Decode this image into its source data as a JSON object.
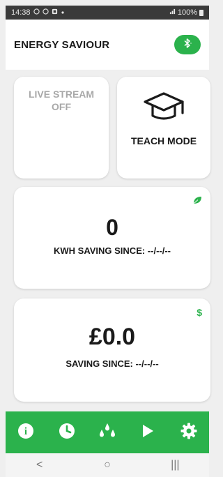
{
  "status_bar": {
    "time": "14:38",
    "notification_icons": [
      "whatsapp-icon",
      "whatsapp-icon",
      "gallery-icon",
      "dot-icon"
    ],
    "signal_icon": "signal-icon",
    "battery_percent": "100%",
    "battery_icon": "battery-icon"
  },
  "header": {
    "title": "ENERGY SAVIOUR",
    "bluetooth_icon": "bluetooth-icon"
  },
  "cards": {
    "live_stream": {
      "line1": "LIVE STREAM",
      "line2": "OFF"
    },
    "teach_mode": {
      "label": "TEACH MODE",
      "icon": "graduation-cap-icon"
    },
    "kwh": {
      "value": "0",
      "label": "KWH SAVING SINCE: --/--/--",
      "icon": "leaf-icon"
    },
    "money": {
      "value": "£0.0",
      "label": "SAVING SINCE: --/--/--",
      "icon": "dollar-icon",
      "icon_text": "$"
    }
  },
  "bottom_nav": {
    "items": [
      {
        "icon": "info-icon",
        "glyph": "i"
      },
      {
        "icon": "clock-icon"
      },
      {
        "icon": "water-drops-icon"
      },
      {
        "icon": "play-icon"
      },
      {
        "icon": "settings-gear-icon"
      }
    ]
  },
  "system_nav": {
    "back": "<",
    "home": "○",
    "recents": "|||"
  },
  "colors": {
    "accent_green": "#2bb24c",
    "background": "#efefef",
    "card": "#ffffff",
    "muted_text": "#a8a8a8"
  }
}
